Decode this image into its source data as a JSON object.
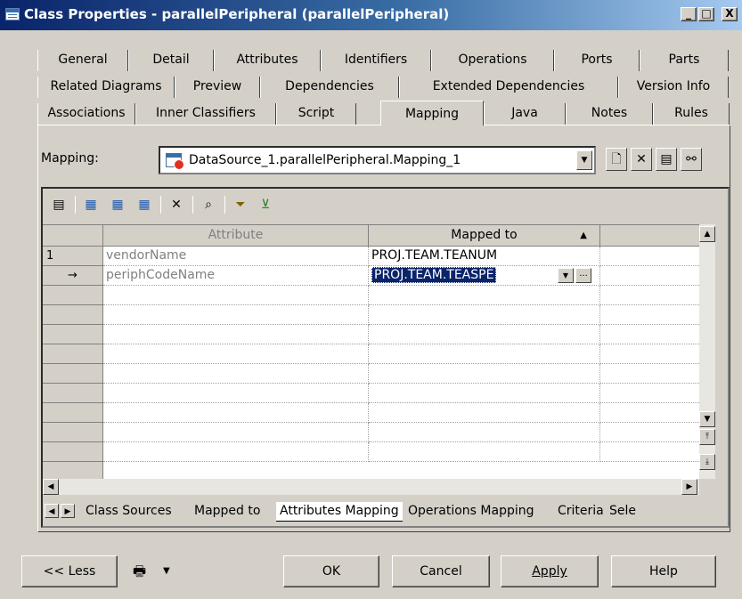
{
  "window": {
    "title": "Class Properties - parallelPeripheral (parallelPeripheral)",
    "controls": {
      "minimize": "_",
      "maximize": "□",
      "close": "X"
    }
  },
  "tabs": {
    "row1": [
      "General",
      "Detail",
      "Attributes",
      "Identifiers",
      "Operations",
      "Ports",
      "Parts"
    ],
    "row2": [
      "Related Diagrams",
      "Preview",
      "Dependencies",
      "Extended Dependencies",
      "Version Info"
    ],
    "row3": [
      "Associations",
      "Inner Classifiers",
      "Script",
      "Mapping",
      "Java",
      "Notes",
      "Rules"
    ],
    "active": "Mapping"
  },
  "mapping": {
    "label": "Mapping:",
    "selected": "DataSource_1.parallelPeripheral.Mapping_1"
  },
  "grid": {
    "columns": [
      "Attribute",
      "Mapped to"
    ],
    "rows": [
      {
        "marker": "1",
        "attribute": "vendorName",
        "mapped_to": "PROJ.TEAM.TEANUM"
      },
      {
        "marker": "→",
        "attribute": "periphCodeName",
        "mapped_to": "PROJ.TEAM.TEASPE"
      }
    ],
    "ellipsis": "..."
  },
  "sheet_tabs": [
    "Class Sources",
    "Mapped to",
    "Attributes Mapping",
    "Operations Mapping",
    "Criteria",
    "Sele"
  ],
  "active_sheet": "Attributes Mapping",
  "buttons": {
    "less": "<< Less",
    "ok": "OK",
    "cancel": "Cancel",
    "apply": "Apply",
    "help": "Help"
  },
  "colors": {
    "title_start": "#0a246a",
    "title_end": "#a6caf0",
    "selection": "#0a246a",
    "face": "#d4d0c8"
  }
}
